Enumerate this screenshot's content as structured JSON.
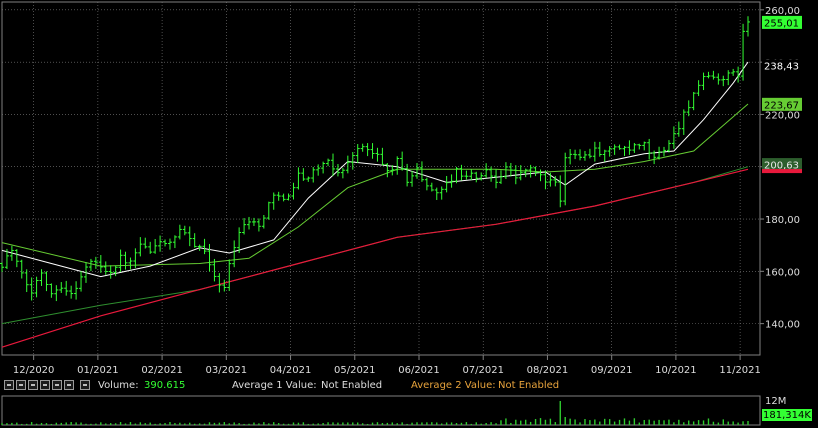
{
  "chart_data": {
    "type": "candlestick",
    "x_ticks": [
      "12/2020",
      "01/2021",
      "02/2021",
      "03/2021",
      "04/2021",
      "05/2021",
      "06/2021",
      "07/2021",
      "08/2021",
      "09/2021",
      "10/2021",
      "11/2021"
    ],
    "y_ticks": [
      "140,00",
      "160,00",
      "180,00",
      "200,00",
      "220,00",
      "240,00",
      "260,00"
    ],
    "ylim": [
      128,
      263
    ],
    "price_path": [
      [
        0,
        163
      ],
      [
        2,
        168
      ],
      [
        4,
        158
      ],
      [
        6,
        152
      ],
      [
        8,
        160
      ],
      [
        10,
        152
      ],
      [
        12,
        155
      ],
      [
        14,
        151
      ],
      [
        16,
        158
      ],
      [
        18,
        164
      ],
      [
        20,
        162
      ],
      [
        22,
        160
      ],
      [
        24,
        165
      ],
      [
        26,
        163
      ],
      [
        28,
        170
      ],
      [
        30,
        167
      ],
      [
        32,
        172
      ],
      [
        34,
        170
      ],
      [
        36,
        175
      ],
      [
        38,
        172
      ],
      [
        40,
        170
      ],
      [
        42,
        163
      ],
      [
        44,
        155
      ],
      [
        45,
        153
      ],
      [
        46,
        163
      ],
      [
        48,
        176
      ],
      [
        50,
        180
      ],
      [
        52,
        177
      ],
      [
        54,
        186
      ],
      [
        56,
        190
      ],
      [
        58,
        188
      ],
      [
        60,
        197
      ],
      [
        62,
        196
      ],
      [
        64,
        200
      ],
      [
        66,
        201
      ],
      [
        68,
        198
      ],
      [
        70,
        201
      ],
      [
        72,
        208
      ],
      [
        74,
        206
      ],
      [
        76,
        204
      ],
      [
        78,
        198
      ],
      [
        80,
        202
      ],
      [
        82,
        195
      ],
      [
        84,
        199
      ],
      [
        86,
        192
      ],
      [
        88,
        191
      ],
      [
        90,
        193
      ],
      [
        92,
        198
      ],
      [
        94,
        197
      ],
      [
        96,
        196
      ],
      [
        98,
        198
      ],
      [
        100,
        195
      ],
      [
        102,
        200
      ],
      [
        104,
        196
      ],
      [
        106,
        199
      ],
      [
        108,
        198
      ],
      [
        110,
        195
      ],
      [
        112,
        193
      ],
      [
        113,
        187
      ],
      [
        114,
        203
      ],
      [
        116,
        206
      ],
      [
        118,
        204
      ],
      [
        120,
        207
      ],
      [
        122,
        205
      ],
      [
        124,
        208
      ],
      [
        126,
        206
      ],
      [
        128,
        207
      ],
      [
        130,
        208
      ],
      [
        132,
        203
      ],
      [
        134,
        207
      ],
      [
        136,
        212
      ],
      [
        138,
        220
      ],
      [
        140,
        228
      ],
      [
        142,
        233
      ],
      [
        144,
        234
      ],
      [
        146,
        234
      ],
      [
        148,
        235
      ],
      [
        149,
        236
      ],
      [
        150,
        251
      ],
      [
        151,
        255
      ]
    ],
    "price_last": "255,01",
    "ma_short_last": "238,43",
    "ma_mid_last": "223,67",
    "ma_long_last": "200,63",
    "ma_short": [
      [
        0,
        168
      ],
      [
        10,
        163
      ],
      [
        20,
        158
      ],
      [
        30,
        162
      ],
      [
        40,
        169
      ],
      [
        46,
        167
      ],
      [
        55,
        172
      ],
      [
        62,
        188
      ],
      [
        70,
        202
      ],
      [
        80,
        200
      ],
      [
        90,
        194
      ],
      [
        100,
        196
      ],
      [
        110,
        198
      ],
      [
        114,
        193
      ],
      [
        120,
        201
      ],
      [
        130,
        205
      ],
      [
        136,
        206
      ],
      [
        142,
        218
      ],
      [
        148,
        232
      ],
      [
        151,
        240
      ]
    ],
    "ma_mid": [
      [
        0,
        171
      ],
      [
        20,
        162
      ],
      [
        40,
        163
      ],
      [
        50,
        165
      ],
      [
        60,
        177
      ],
      [
        70,
        192
      ],
      [
        80,
        199
      ],
      [
        100,
        199
      ],
      [
        110,
        198
      ],
      [
        120,
        199
      ],
      [
        130,
        202
      ],
      [
        140,
        206
      ],
      [
        151,
        224
      ]
    ],
    "ma_long": [
      [
        0,
        131
      ],
      [
        20,
        143
      ],
      [
        40,
        153
      ],
      [
        60,
        163
      ],
      [
        80,
        173
      ],
      [
        100,
        178
      ],
      [
        120,
        185
      ],
      [
        140,
        194
      ],
      [
        151,
        199
      ]
    ],
    "ma_longest": [
      [
        0,
        140
      ],
      [
        20,
        147
      ],
      [
        40,
        153
      ],
      [
        60,
        163
      ],
      [
        80,
        173
      ],
      [
        100,
        178
      ],
      [
        120,
        185
      ],
      [
        140,
        194
      ],
      [
        151,
        200
      ]
    ],
    "volume_spike_index": 113,
    "volume_ylim_label": "12M",
    "volume_last": "181,314K"
  },
  "volume_bar": {
    "volume_label": "Volume:",
    "volume_value": "390.615",
    "avg1_label": "Average 1 Value:",
    "avg1_value": "Not Enabled",
    "avg2_label": "Average 2 Value:",
    "avg2_value": "Not Enabled"
  },
  "colors": {
    "price": "#33ff33",
    "ma_short": "#ffffff",
    "ma_mid": "#66cc33",
    "ma_long": "#e8193c",
    "ma_longest": "#2f8f2f",
    "grid": "#7f7f7f",
    "text": "#dddddd",
    "avg2": "#e8a33c",
    "volume": "#2fcb2f"
  }
}
